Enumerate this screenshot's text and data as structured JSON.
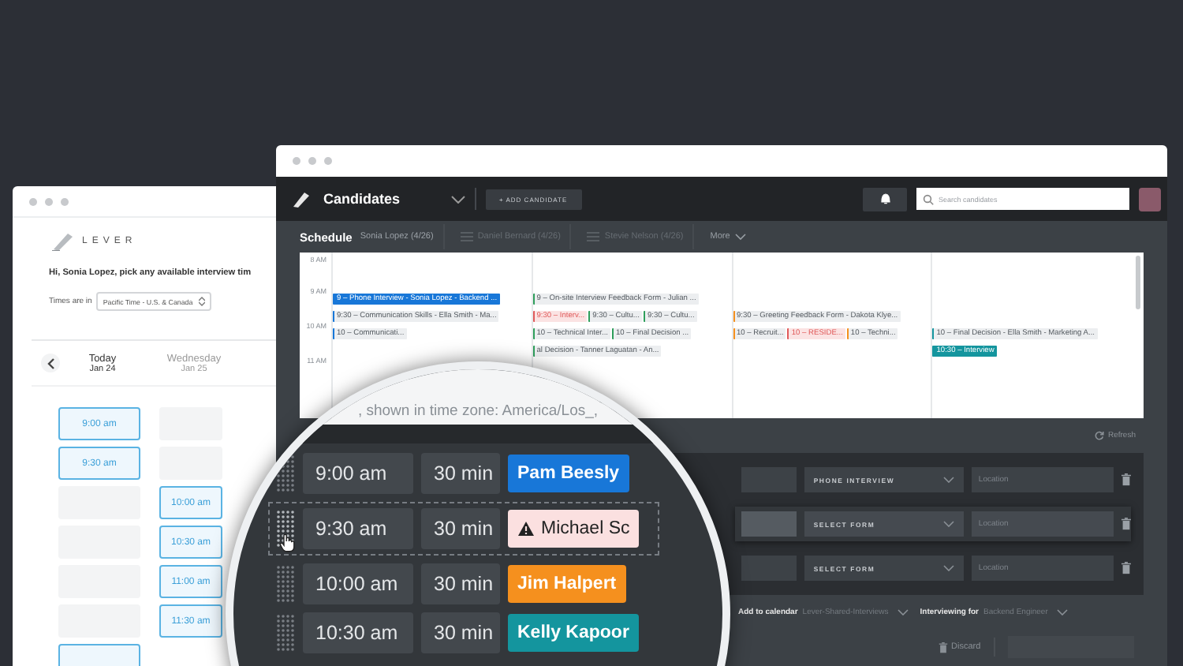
{
  "booking_page": {
    "logo": "LEVER",
    "greeting": "Hi, Sonia Lopez, pick any available interview tim",
    "timezone_label": "Times are in",
    "timezone": "Pacific Time - U.S. & Canada",
    "days": [
      {
        "day": "Today",
        "date": "Jan 24",
        "slots": [
          {
            "label": "9:00 am",
            "available": true
          },
          {
            "label": "9:30 am",
            "available": true
          },
          {
            "available": false
          },
          {
            "available": false
          },
          {
            "available": false
          },
          {
            "available": false
          },
          {
            "available": true
          }
        ]
      },
      {
        "day": "Wednesday",
        "date": "Jan 25",
        "slots": [
          {
            "available": false
          },
          {
            "available": false
          },
          {
            "label": "10:00 am",
            "available": true
          },
          {
            "label": "10:30 am",
            "available": true
          },
          {
            "label": "11:00 am",
            "available": true
          },
          {
            "label": "11:30 am",
            "available": true
          }
        ]
      }
    ]
  },
  "app": {
    "title": "Candidates",
    "add_button": "+ ADD CANDIDATE",
    "search": {
      "placeholder": "Search candidates"
    },
    "schedule_title": "Schedule",
    "tabs": [
      {
        "label": "Sonia Lopez (4/26)",
        "selected": true
      },
      {
        "label": "Daniel Bernard (4/26)",
        "selected": false
      },
      {
        "label": "Stevie Nelson (4/26)",
        "selected": false
      }
    ],
    "more": "More",
    "calendar": {
      "rows": [
        {
          "time": "8 AM",
          "columns": [
            [],
            [],
            [],
            []
          ]
        },
        {
          "time": "9 AM",
          "columns": [
            [
              {
                "text": "9 – Phone Interview - Sonia Lopez - Backend ...",
                "color": "#1877d8",
                "kind": "filled"
              }
            ],
            [
              {
                "text": "9 – On-site Interview Feedback Form - Julian ...",
                "color": "#2e9e5b",
                "kind": "bar"
              }
            ],
            [],
            []
          ]
        },
        {
          "columns": [
            [
              {
                "text": "9:30 – Communication Skills - Ella Smith - Ma...",
                "color": "#1877d8",
                "kind": "bar"
              }
            ],
            [
              {
                "text": "9:30 – Interv...",
                "color": "#e05a5a",
                "kind": "tint"
              },
              {
                "text": "9:30 – Cultu...",
                "color": "#2e9e5b",
                "kind": "bar"
              },
              {
                "text": "9:30 – Cultu...",
                "color": "#2e9e5b",
                "kind": "bar"
              }
            ],
            [
              {
                "text": "9:30 – Greeting Feedback Form - Dakota Klye...",
                "color": "#f5901e",
                "kind": "bar"
              }
            ],
            []
          ]
        },
        {
          "time": "10 AM",
          "columns": [
            [
              {
                "text": "10 – Communicati...",
                "color": "#1877d8",
                "kind": "bar"
              }
            ],
            [
              {
                "text": "10 – Technical Inter...",
                "color": "#2e9e5b",
                "kind": "bar"
              },
              {
                "text": "10 – Final Decision ...",
                "color": "#2e9e5b",
                "kind": "bar"
              }
            ],
            [
              {
                "text": "10 – Recruit...",
                "color": "#f5901e",
                "kind": "bar"
              },
              {
                "text": "10 – RESIDE...",
                "color": "#e05a5a",
                "kind": "tint"
              },
              {
                "text": "10 – Techni...",
                "color": "#f5901e",
                "kind": "bar"
              }
            ],
            [
              {
                "text": "10 – Final Decision - Ella Smith - Marketing A...",
                "color": "#14959e",
                "kind": "bar"
              }
            ]
          ]
        },
        {
          "columns": [
            [],
            [
              {
                "text": "al Decision - Tanner Laguatan - An...",
                "color": "#2e9e5b",
                "kind": "bar"
              }
            ],
            [],
            [
              {
                "text": "10:30 – Interview",
                "color": "#14959e",
                "kind": "filled"
              }
            ]
          ]
        },
        {
          "time": "11 AM",
          "columns": [
            [],
            [],
            [],
            []
          ]
        }
      ]
    },
    "refresh": "Refresh",
    "timezone_note": ", shown in time zone: America/Los_,",
    "interviews": [
      {
        "time": "9:00 am",
        "duration": "30 min",
        "interviewer": "Pam Beesly",
        "color": "#1877d8",
        "conflict": false,
        "dragging": false
      },
      {
        "time": "9:30 am",
        "duration": "30 min",
        "interviewer": "Michael Sc",
        "color": "#fbe0e0",
        "conflict": true,
        "dragging": true
      },
      {
        "time": "10:00 am",
        "duration": "30 min",
        "interviewer": "Jim Halpert",
        "color": "#f5901e",
        "conflict": false,
        "dragging": false
      },
      {
        "time": "10:30 am",
        "duration": "30 min",
        "interviewer": "Kelly Kapoor",
        "color": "#14959e",
        "conflict": false,
        "dragging": false
      }
    ],
    "rows": [
      {
        "form": "PHONE INTERVIEW",
        "placeholder": "Location",
        "raised": false
      },
      {
        "form": "SELECT FORM",
        "placeholder": "Location",
        "raised": true
      },
      {
        "form": "SELECT FORM",
        "placeholder": "Location",
        "raised": false
      }
    ],
    "calendar_label": "Add to calendar",
    "calendar_value": "Lever-Shared-Interviews",
    "for_label": "Interviewing for",
    "for_value": "Backend Engineer",
    "discard": "Discard"
  }
}
